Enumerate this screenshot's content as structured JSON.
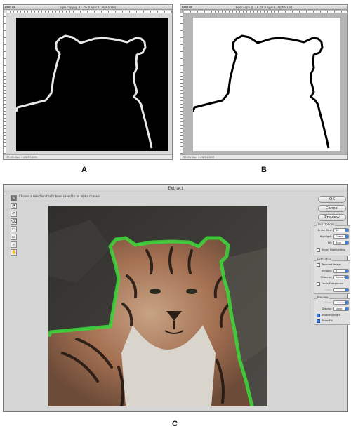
{
  "window_a": {
    "title": "tiger copy @ 33.3% (Layer 1, Alpha 1/8)",
    "status": "33.3%   Doc: 1.26M/1.69M"
  },
  "window_b": {
    "title": "tiger copy @ 33.3% (Layer 1, Alpha 1/8)",
    "status": "33.3%   Doc: 1.26M/1.69M"
  },
  "labels": {
    "a": "A",
    "b": "B",
    "c": "C"
  },
  "extract": {
    "title": "Extract",
    "instruction": "Choose a selection that's been saved to an alpha channel",
    "tools": [
      "✎",
      "◔",
      "✐",
      "⌫",
      "▭",
      "▭",
      "⌕",
      "✋"
    ],
    "buttons": {
      "ok": "OK",
      "cancel": "Cancel",
      "preview": "Preview"
    },
    "tool_options": {
      "title": "Tool Options",
      "brush_size_label": "Brush Size:",
      "brush_size": "15",
      "highlight_label": "Highlight:",
      "highlight": "Green",
      "fill_label": "Fill:",
      "fill": "Blue",
      "smart_highlighting": "Smart Highlighting"
    },
    "extraction": {
      "title": "Extraction",
      "textured_image": "Textured Image",
      "smooth_label": "Smooth:",
      "smooth": "0",
      "channel_label": "Channel:",
      "channel": "Alpha 1",
      "force_foreground": "Force Foreground",
      "color_label": "Color:"
    },
    "preview": {
      "title": "Preview",
      "show_label": "Show:",
      "show": "Original",
      "display_label": "Display:",
      "display": "None",
      "show_highlight": "Show Highlight",
      "show_fill": "Show Fill"
    }
  },
  "colors": {
    "highlight_green": "#3fd33a",
    "accent_blue": "#3d7de0"
  }
}
